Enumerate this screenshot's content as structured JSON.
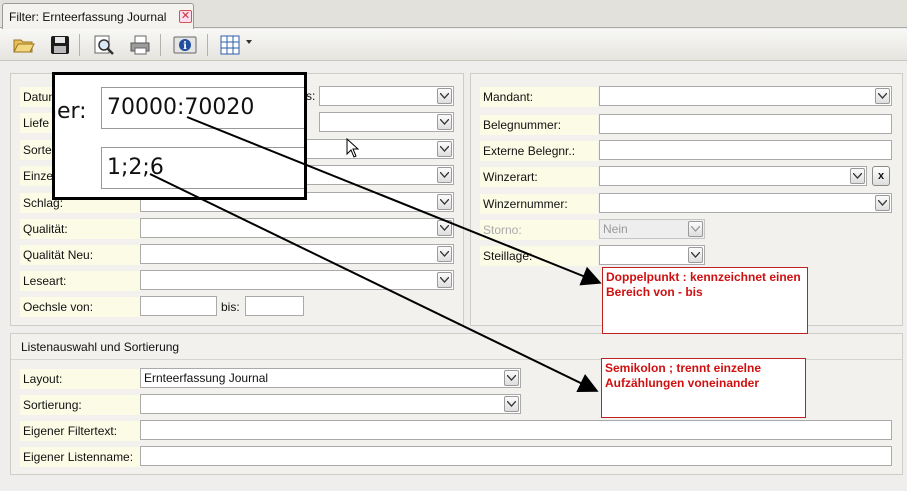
{
  "tab": {
    "title": "Filter: Ernteerfassung Journal",
    "close_icon": "close-icon"
  },
  "toolbar": {
    "icons": [
      "open-folder-icon",
      "save-icon",
      "print-preview-icon",
      "print-icon",
      "info-icon",
      "table-layout-icon",
      "dropdown-arrow-icon"
    ]
  },
  "left_filters": {
    "datum": {
      "label": "Datum",
      "partial_label": "s:",
      "value": ""
    },
    "lieferant": {
      "label": "Liefe",
      "value": ""
    },
    "sorte": {
      "label": "Sorte",
      "value": ""
    },
    "einzel": {
      "label": "Einze",
      "value": ""
    },
    "schlag": {
      "label": "Schlag:",
      "value": ""
    },
    "qualitaet": {
      "label": "Qualität:",
      "value": ""
    },
    "qualitaet_neu": {
      "label": "Qualität Neu:",
      "value": ""
    },
    "leseart": {
      "label": "Leseart:",
      "value": ""
    },
    "oechsle": {
      "label": "Oechsle von:",
      "bis_label": "bis:",
      "from": "",
      "to": ""
    }
  },
  "right_filters": {
    "mandant": {
      "label": "Mandant:",
      "value": ""
    },
    "belegnummer": {
      "label": "Belegnummer:",
      "value": ""
    },
    "externe_belegnr": {
      "label": "Externe Belegnr.:",
      "value": ""
    },
    "winzerart": {
      "label": "Winzerart:",
      "value": "",
      "clear_label": "x"
    },
    "winzernummer": {
      "label": "Winzernummer:",
      "value": ""
    },
    "storno": {
      "label": "Storno:",
      "value": "Nein"
    },
    "steillage": {
      "label": "Steillage:",
      "value": ""
    }
  },
  "list_section": {
    "title": "Listenauswahl und Sortierung",
    "layout": {
      "label": "Layout:",
      "value": "Ernteerfassung Journal"
    },
    "sortierung": {
      "label": "Sortierung:",
      "value": ""
    },
    "eigener_filtertext": {
      "label": "Eigener Filtertext:",
      "value": ""
    },
    "eigener_listenname": {
      "label": "Eigener Listenname:",
      "value": ""
    }
  },
  "zoom_callout": {
    "label": "ner:",
    "value1": "70000:70020",
    "value2": "1;2;6"
  },
  "annotations": {
    "doppelpunkt": "Doppelpunkt : kennzeichnet einen Bereich von - bis",
    "semikolon": "Semikolon ; trennt einzelne Aufzählungen voneinander",
    "color": "#d01010"
  }
}
